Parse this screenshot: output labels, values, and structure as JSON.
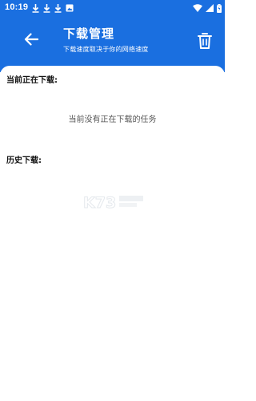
{
  "status_bar": {
    "time": "10:19",
    "left_icons": [
      "download-icon",
      "download-icon",
      "download-icon",
      "image-icon"
    ],
    "right_icons": [
      "wifi-icon",
      "cell-signal-icon",
      "battery-icon"
    ]
  },
  "app_bar": {
    "title": "下载管理",
    "subtitle": "下载速度取决于你的网络速度",
    "back_icon": "arrow-left-icon",
    "delete_icon": "trash-icon"
  },
  "current_section": {
    "title": "当前正在下载:",
    "empty_message": "当前没有正在下载的任务"
  },
  "history_section": {
    "title": "历史下载:"
  },
  "colors": {
    "header_bg": "#1a6fe0",
    "text_primary": "#111111",
    "text_secondary": "#555555"
  }
}
